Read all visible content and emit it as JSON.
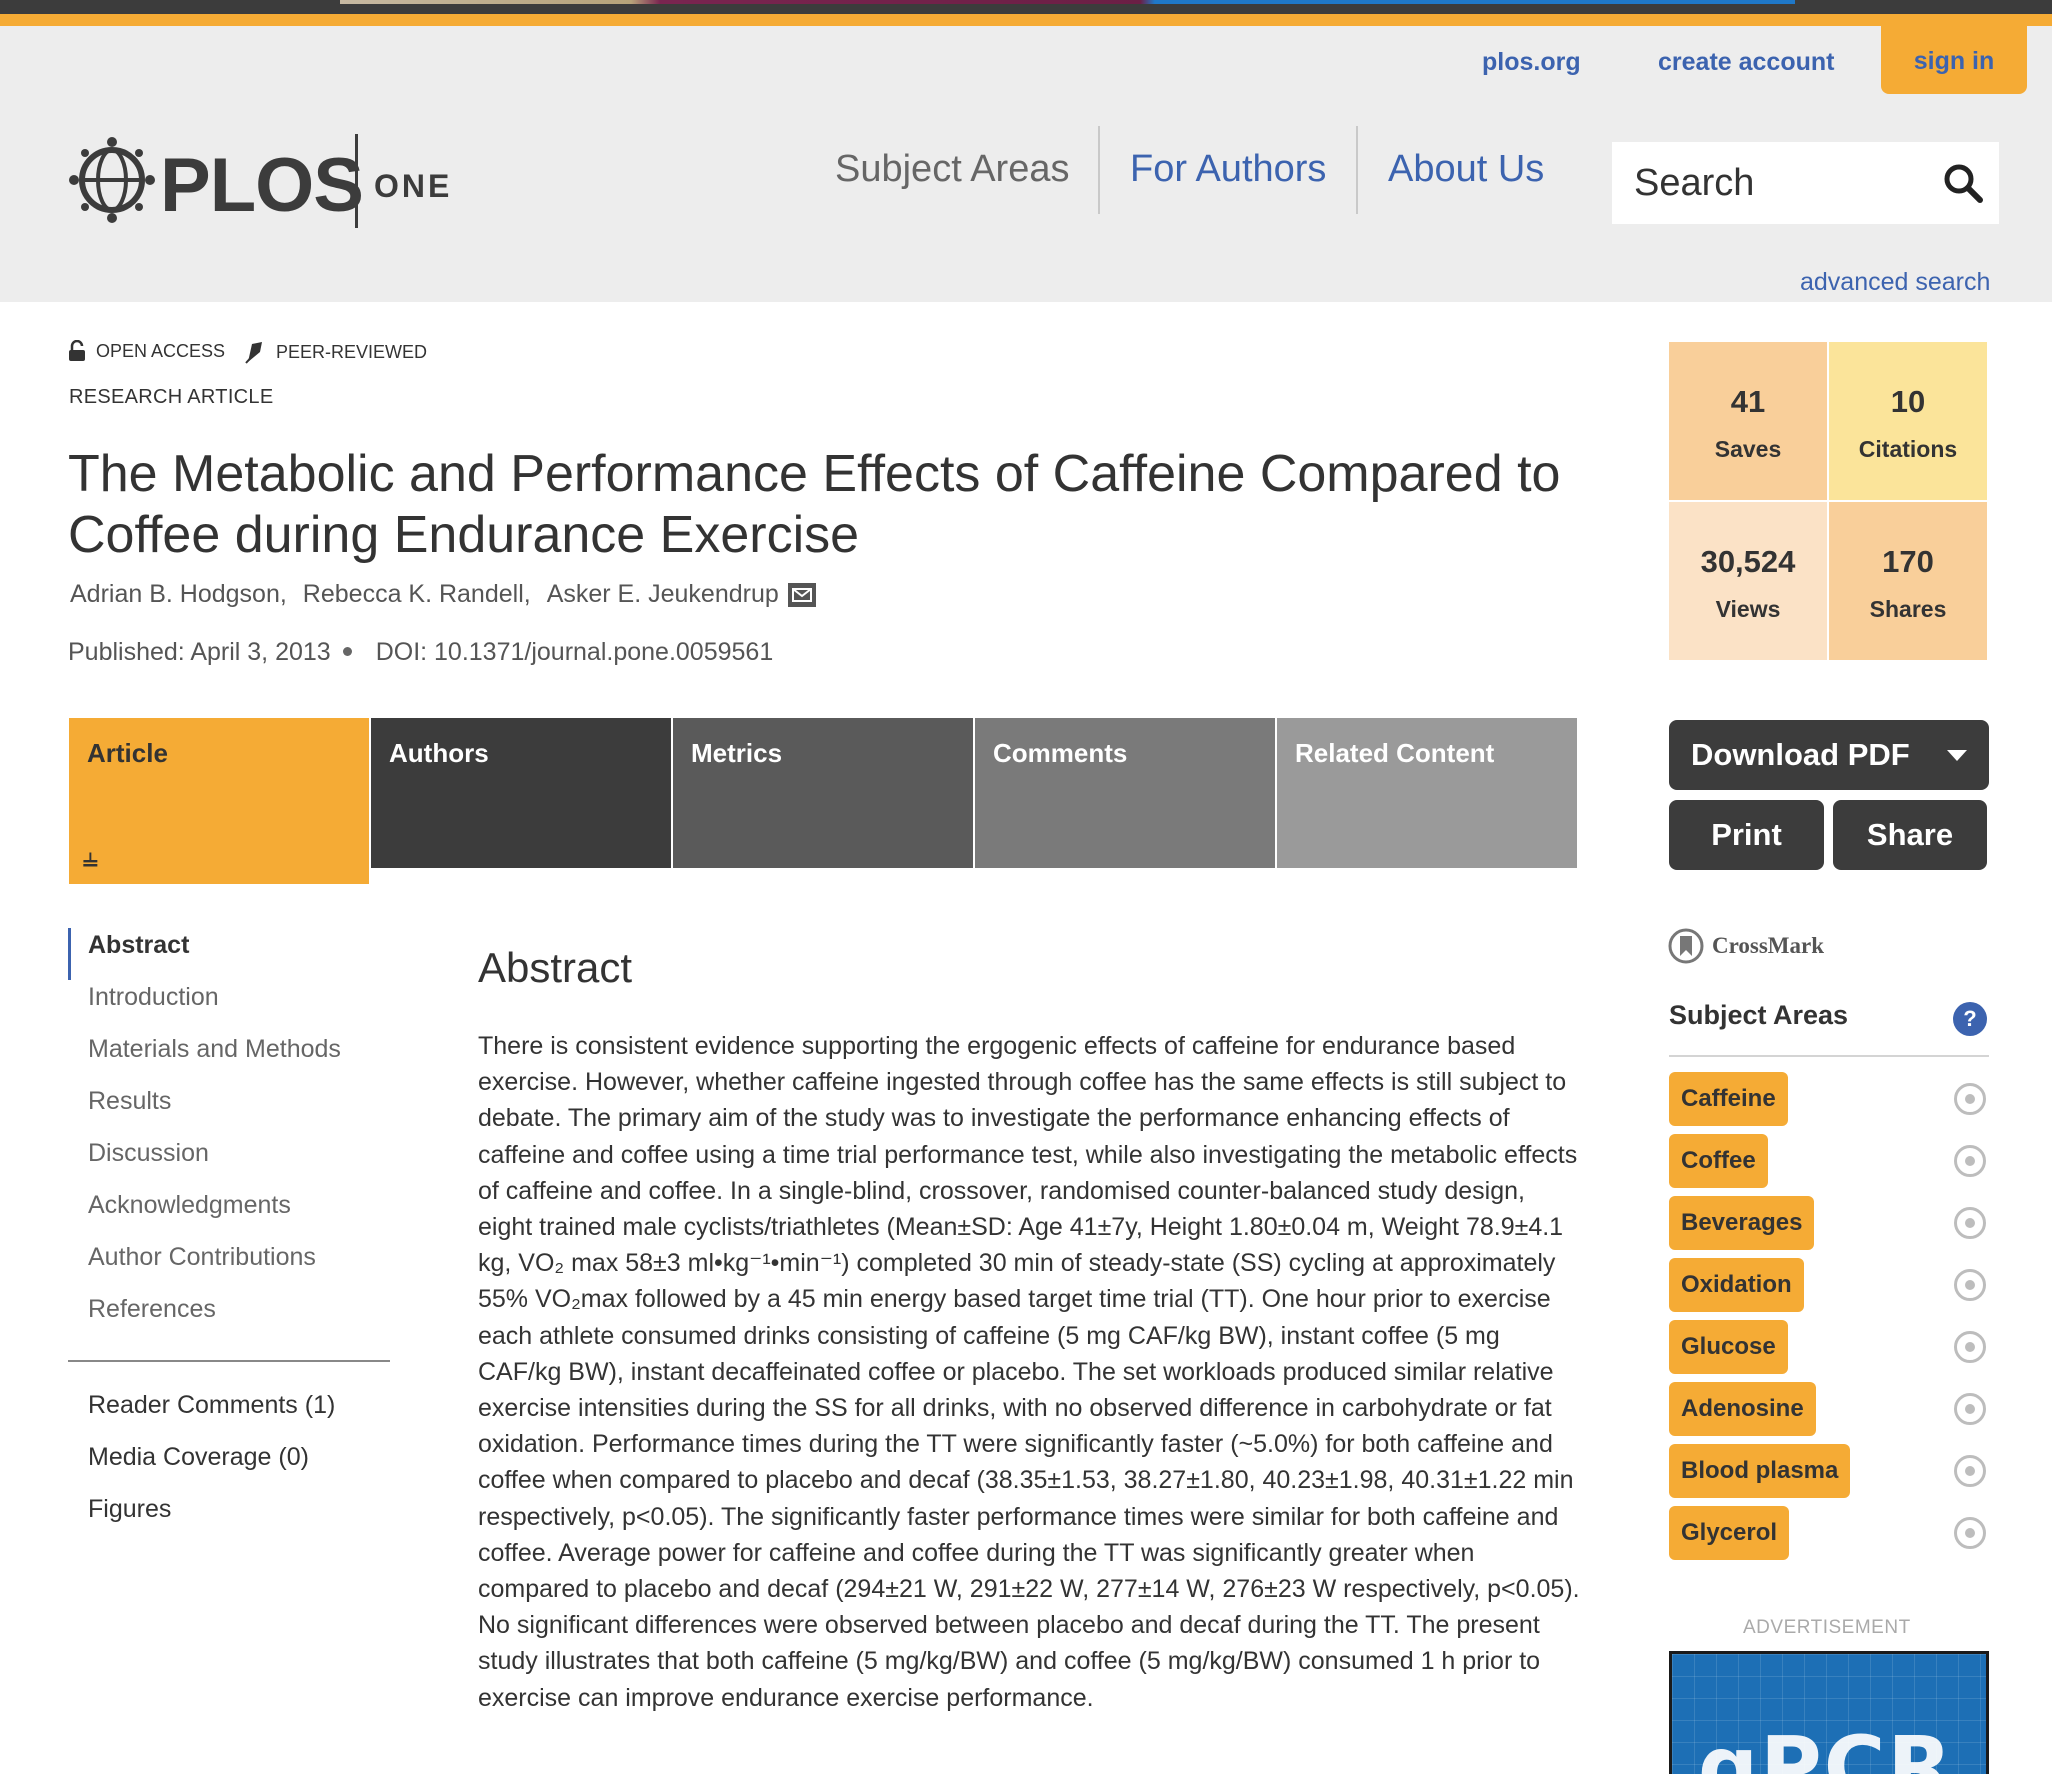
{
  "colors": {
    "accent": "#f5ab35",
    "link": "#3c63af",
    "dark": "#3c3c3c"
  },
  "header": {
    "util_links": [
      "plos.org",
      "create account",
      "sign in"
    ],
    "logo": {
      "brand": "PLOS",
      "journal": "ONE"
    },
    "nav": [
      "Subject Areas",
      "For Authors",
      "About Us"
    ],
    "search_placeholder": "Search",
    "advanced_search": "advanced search"
  },
  "article": {
    "badges": [
      "OPEN ACCESS",
      "PEER-REVIEWED"
    ],
    "type": "RESEARCH ARTICLE",
    "title": "The Metabolic and Performance Effects of Caffeine Compared to Coffee during Endurance Exercise",
    "authors": [
      "Adrian B. Hodgson,",
      "Rebecca K. Randell,",
      "Asker E. Jeukendrup"
    ],
    "published": "Published: April 3, 2013",
    "doi": "DOI: 10.1371/journal.pone.0059561"
  },
  "tabs": [
    "Article",
    "Authors",
    "Metrics",
    "Comments",
    "Related Content"
  ],
  "toc": [
    "Abstract",
    "Introduction",
    "Materials and Methods",
    "Results",
    "Discussion",
    "Acknowledgments",
    "Author Contributions",
    "References"
  ],
  "toc_secondary": [
    "Reader Comments (1)",
    "Media Coverage (0)",
    "Figures"
  ],
  "abstract": {
    "heading": "Abstract",
    "text": "There is consistent evidence supporting the ergogenic effects of caffeine for endurance based exercise. However, whether caffeine ingested through coffee has the same effects is still subject to debate. The primary aim of the study was to investigate the performance enhancing effects of caffeine and coffee using a time trial performance test, while also investigating the metabolic effects of caffeine and coffee. In a single-blind, crossover, randomised counter-balanced study design, eight trained male cyclists/triathletes (Mean±SD: Age 41±7y, Height 1.80±0.04 m, Weight 78.9±4.1 kg, VO₂ max 58±3 ml•kg⁻¹•min⁻¹) completed 30 min of steady-state (SS) cycling at approximately 55% VO₂max followed by a 45 min energy based target time trial (TT). One hour prior to exercise each athlete consumed drinks consisting of caffeine (5 mg CAF/kg BW), instant coffee (5 mg CAF/kg BW), instant decaffeinated coffee or placebo. The set workloads produced similar relative exercise intensities during the SS for all drinks, with no observed difference in carbohydrate or fat oxidation. Performance times during the TT were significantly faster (~5.0%) for both caffeine and coffee when compared to placebo and decaf (38.35±1.53, 38.27±1.80, 40.23±1.98, 40.31±1.22 min respectively, p<0.05). The significantly faster performance times were similar for both caffeine and coffee. Average power for caffeine and coffee during the TT was significantly greater when compared to placebo and decaf (294±21 W, 291±22 W, 277±14 W, 276±23 W respectively, p<0.05). No significant differences were observed between placebo and decaf during the TT. The present study illustrates that both caffeine (5 mg/kg/BW) and coffee (5 mg/kg/BW) consumed 1 h prior to exercise can improve endurance exercise performance."
  },
  "metrics": [
    {
      "value": "41",
      "label": "Saves",
      "color": "#f9cf9a"
    },
    {
      "value": "10",
      "label": "Citations",
      "color": "#fbe49a"
    },
    {
      "value": "30,524",
      "label": "Views",
      "color": "#fbe2c6"
    },
    {
      "value": "170",
      "label": "Shares",
      "color": "#f9cf9a"
    }
  ],
  "actions": {
    "download": "Download PDF",
    "print": "Print",
    "share": "Share"
  },
  "crossmark": "CrossMark",
  "subject_areas": {
    "heading": "Subject Areas",
    "help": "?",
    "items": [
      "Caffeine",
      "Coffee",
      "Beverages",
      "Oxidation",
      "Glucose",
      "Adenosine",
      "Blood plasma",
      "Glycerol"
    ]
  },
  "advertisement": {
    "label": "ADVERTISEMENT",
    "text": "qPCR"
  }
}
